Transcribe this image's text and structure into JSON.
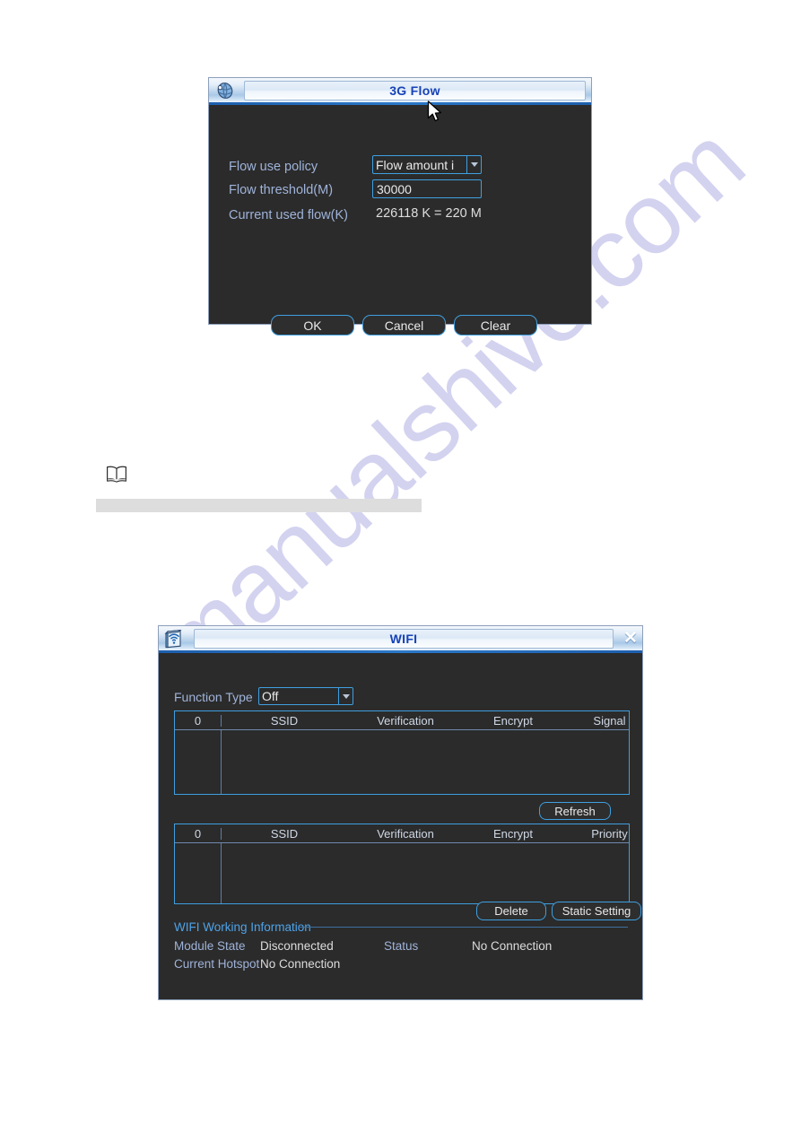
{
  "watermark": {
    "text": "manualshive.com"
  },
  "flow_dialog": {
    "title": "3G Flow",
    "icon": "globe-3g-icon",
    "fields": {
      "policy_label": "Flow use policy",
      "policy_value": "Flow amount i",
      "threshold_label": "Flow threshold(M)",
      "threshold_value": "30000",
      "used_label": "Current used flow(K)",
      "used_value": "226118 K = 220 M"
    },
    "buttons": {
      "ok": "OK",
      "cancel": "Cancel",
      "clear": "Clear"
    }
  },
  "note": {
    "icon": "book-note-icon"
  },
  "wifi_dialog": {
    "title": "WIFI",
    "icon": "wifi-module-icon",
    "close_glyph": "✕",
    "function_type": {
      "label": "Function Type",
      "value": "Off"
    },
    "scan_table": {
      "count": "0",
      "columns": [
        "SSID",
        "Verification",
        "Encrypt",
        "Signal"
      ],
      "rows": []
    },
    "saved_table": {
      "count": "0",
      "columns": [
        "SSID",
        "Verification",
        "Encrypt",
        "Priority"
      ],
      "rows": []
    },
    "buttons": {
      "refresh": "Refresh",
      "delete": "Delete",
      "static_setting": "Static Setting"
    },
    "working_info": {
      "title": "WIFI Working Information",
      "module_state_label": "Module State",
      "module_state_value": "Disconnected",
      "status_label": "Status",
      "status_value": "No Connection",
      "current_hotspot_label": "Current Hotspot",
      "current_hotspot_value": "No Connection"
    }
  },
  "colors": {
    "accent_blue": "#3f9fe0",
    "title_blue": "#1742b7",
    "panel_bg": "#2b2b2b",
    "label_blue": "#9fb3d9"
  }
}
